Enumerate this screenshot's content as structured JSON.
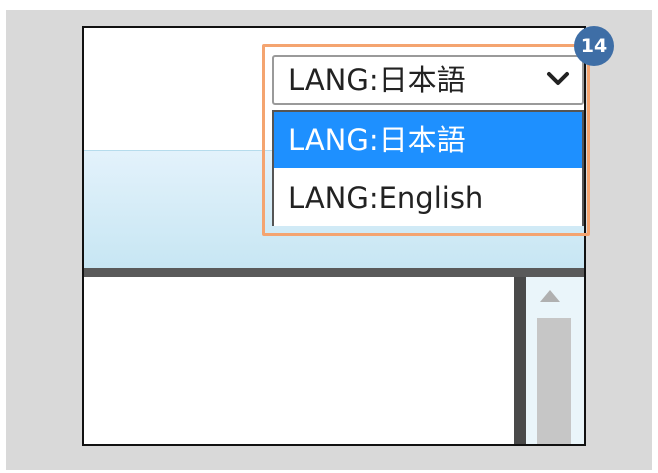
{
  "language_selector": {
    "current_value": "LANG:日本語",
    "options": [
      {
        "label": "LANG:日本語",
        "selected": true
      },
      {
        "label": "LANG:English",
        "selected": false
      }
    ]
  },
  "step_badge": {
    "number": "14"
  },
  "colors": {
    "highlight_border": "#f4a470",
    "badge_background": "#3e6ea6",
    "selected_option_background": "#1e90ff",
    "selected_option_text": "#ffffff",
    "option_text": "#222222",
    "header_band": "#c7e6f3"
  },
  "icons": {
    "dropdown_arrow": "chevron-down-icon",
    "scroll_up": "scroll-up-arrow-icon"
  }
}
